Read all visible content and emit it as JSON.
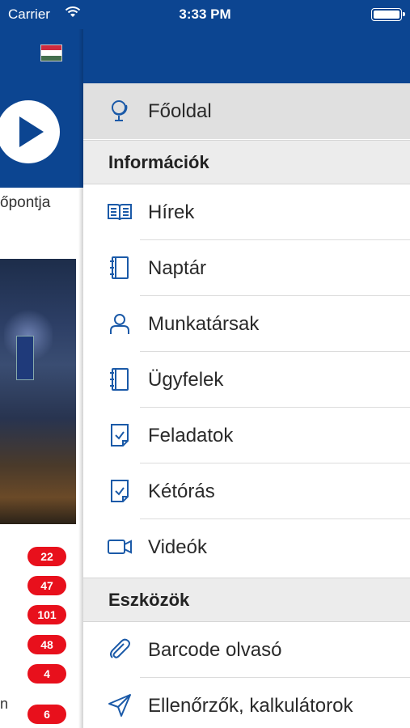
{
  "status_bar": {
    "carrier": "Carrier",
    "time": "3:33 PM"
  },
  "background_page": {
    "text_fragment": "őpontja",
    "badges": [
      "22",
      "47",
      "101",
      "48",
      "4",
      "6"
    ],
    "letter_fragment": "n",
    "colors": {
      "brand_blue": "#0c4591",
      "badge_red": "#e8101c"
    }
  },
  "drawer": {
    "main_item": {
      "label": "Főoldal",
      "icon": "globe-icon"
    },
    "sections": [
      {
        "title": "Információk",
        "items": [
          {
            "label": "Hírek",
            "icon": "book-open-icon"
          },
          {
            "label": "Naptár",
            "icon": "notebook-icon"
          },
          {
            "label": "Munkatársak",
            "icon": "person-icon"
          },
          {
            "label": "Ügyfelek",
            "icon": "notebook-icon"
          },
          {
            "label": "Feladatok",
            "icon": "checked-document-icon"
          },
          {
            "label": "Kétórás",
            "icon": "checked-document-icon"
          },
          {
            "label": "Videók",
            "icon": "video-camera-icon"
          }
        ]
      },
      {
        "title": "Eszközök",
        "items": [
          {
            "label": "Barcode olvasó",
            "icon": "paperclip-icon"
          },
          {
            "label": "Ellenőrzők, kalkulátorok",
            "icon": "send-icon"
          }
        ]
      }
    ]
  }
}
